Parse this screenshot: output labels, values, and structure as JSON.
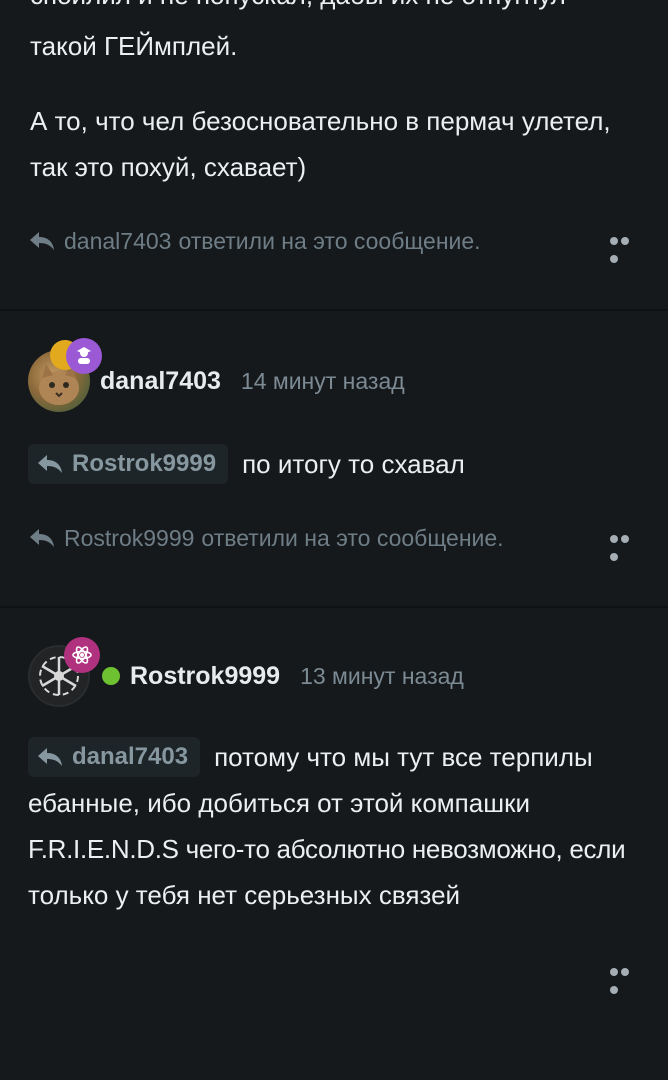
{
  "post1": {
    "partial_line": "спойлил и не попускал, дабы их не отпугнул",
    "line2": "такой ГЕЙмплей.",
    "para2_line1": "А то, что чел безосновательно в пермач улетел,",
    "para2_line2": "так это похуй, схавает)",
    "replied_user": "danal7403",
    "replied_text": "ответили на это сообщение."
  },
  "post2": {
    "username": "danal7403",
    "time": "14 минут назад",
    "quote_user": "Rostrok9999",
    "text": "по итогу то схавал",
    "replied_user": "Rostrok9999",
    "replied_text": "ответили на это сообщение."
  },
  "post3": {
    "username": "Rostrok9999",
    "time": "13 минут назад",
    "quote_user": "danal7403",
    "text_line1": "потому что мы тут все терпилы",
    "text_line2": "ебанные, ибо добиться от этой компашки",
    "text_line3": "F.R.I.E.N.D.S чего-то абсолютно невозможно, если",
    "text_line4": "только у тебя нет серьезных связей"
  },
  "colors": {
    "background": "#15191c",
    "online": "#6ec231",
    "badge_purple": "#9b59d6",
    "badge_magenta": "#b0317e",
    "badge_gold": "#e2a91f"
  },
  "icons": [
    "reply-icon",
    "more-icon",
    "graduation-cap-icon",
    "atom-icon"
  ]
}
